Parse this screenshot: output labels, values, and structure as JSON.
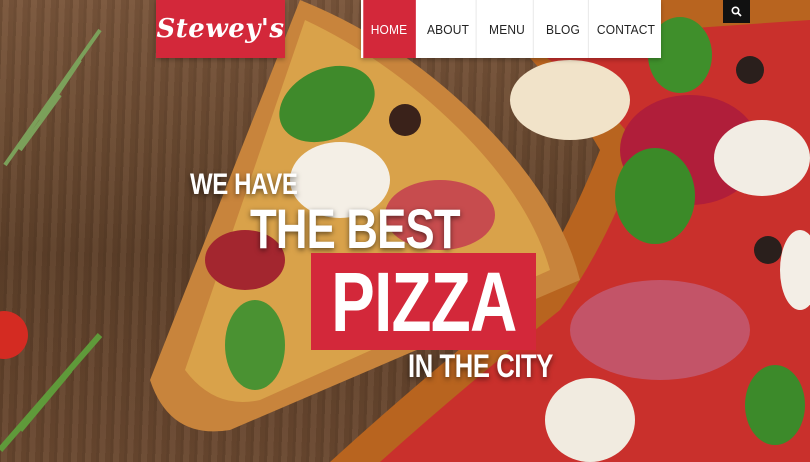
{
  "brand": {
    "logo_text": "Stewey's",
    "accent_color": "#d3283a"
  },
  "nav": {
    "items": [
      {
        "label": "HOME",
        "active": true
      },
      {
        "label": "ABOUT",
        "active": false
      },
      {
        "label": "MENU",
        "active": false
      },
      {
        "label": "BLOG",
        "active": false
      },
      {
        "label": "CONTACT",
        "active": false
      }
    ],
    "search_icon": "search-icon"
  },
  "hero": {
    "line1": "WE HAVE",
    "line2": "THE BEST",
    "line3": "PIZZA",
    "line4": "IN THE CITY",
    "background": "pizza-on-wooden-table-photo"
  }
}
